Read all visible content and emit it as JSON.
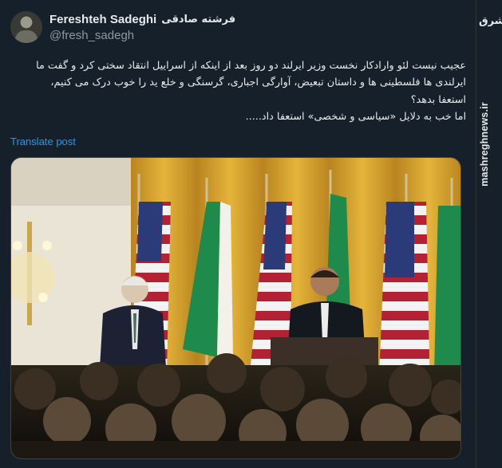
{
  "author": {
    "display_name": "Fereshteh Sadeghi",
    "display_name_fa": "فرشته صادقی",
    "handle": "@fresh_sadegh"
  },
  "tweet": {
    "lines": [
      "عجیب نیست لئو وارادکار نخست وزیر ایرلند دو روز بعد از اینکه از اسراییل انتقاد سختی کرد و گفت ما",
      "ایرلندی ها فلسطینی ها و داستان تبعیض، آوارگی اجباری، گرسنگی و خلع ید را خوب درک می کنیم،",
      "استعفا بدهد؟",
      "اما خب به دلایل «سیاسی و شخصی» استعفا داد....."
    ],
    "translate_label": "Translate post"
  },
  "watermark": {
    "logo": "مشرق",
    "site": "mashreghnews.ir"
  },
  "colors": {
    "background": "#15202b",
    "text": "#e7e9ea",
    "secondary": "#8b98a5",
    "link": "#1d9bf0",
    "curtain": "#d8a12a"
  },
  "icons": [
    "avatar",
    "photo-attachment"
  ]
}
